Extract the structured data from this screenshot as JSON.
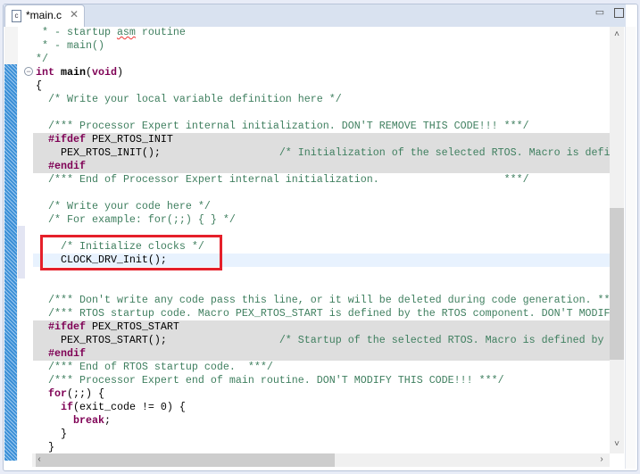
{
  "tab": {
    "title": "*main.c",
    "file_icon": "c-file-icon",
    "close_icon": "close-icon"
  },
  "window": {
    "minimize_icon": "minimize-icon",
    "maximize_icon": "maximize-icon"
  },
  "editor": {
    "fold_icon": "collapse-icon",
    "highlight_color": "#e5202a",
    "lines": [
      {
        "k": "",
        "t": [
          [
            "cm",
            " * - startup "
          ],
          [
            "cm sq",
            "asm"
          ],
          [
            "cm",
            " routine"
          ]
        ]
      },
      {
        "k": "",
        "t": [
          [
            "cm",
            " * - main()"
          ]
        ]
      },
      {
        "k": "",
        "t": [
          [
            "cm",
            "*/"
          ]
        ]
      },
      {
        "k": "",
        "t": [
          [
            "kw",
            "int"
          ],
          [
            "",
            " "
          ],
          [
            "fn",
            "main"
          ],
          [
            "",
            "("
          ],
          [
            "kw",
            "void"
          ],
          [
            "",
            ")"
          ]
        ]
      },
      {
        "k": "",
        "t": [
          [
            "",
            "{"
          ]
        ]
      },
      {
        "k": "",
        "t": [
          [
            "",
            "  "
          ],
          [
            "cm",
            "/* Write your local variable definition here */"
          ]
        ]
      },
      {
        "k": "",
        "t": []
      },
      {
        "k": "",
        "t": [
          [
            "",
            "  "
          ],
          [
            "cm",
            "/*** Processor Expert internal initialization. DON'T REMOVE THIS CODE!!! ***/"
          ]
        ]
      },
      {
        "k": "pp",
        "t": [
          [
            "",
            "  "
          ],
          [
            "kw",
            "#ifdef"
          ],
          [
            "",
            " PEX_RTOS_INIT"
          ]
        ]
      },
      {
        "k": "pp",
        "t": [
          [
            "",
            "    PEX_RTOS_INIT();                   "
          ],
          [
            "cm",
            "/* Initialization of the selected RTOS. Macro is defi"
          ]
        ]
      },
      {
        "k": "pp",
        "t": [
          [
            "",
            "  "
          ],
          [
            "kw",
            "#endif"
          ]
        ]
      },
      {
        "k": "",
        "t": [
          [
            "",
            "  "
          ],
          [
            "cm",
            "/*** End of Processor Expert internal initialization.                    ***/"
          ]
        ]
      },
      {
        "k": "",
        "t": []
      },
      {
        "k": "",
        "t": [
          [
            "",
            "  "
          ],
          [
            "cm",
            "/* Write your code here */"
          ]
        ]
      },
      {
        "k": "",
        "t": [
          [
            "",
            "  "
          ],
          [
            "cm",
            "/* For example: for(;;) { } */"
          ]
        ]
      },
      {
        "k": "",
        "t": []
      },
      {
        "k": "",
        "t": [
          [
            "",
            "    "
          ],
          [
            "cm",
            "/* Initialize clocks */"
          ]
        ]
      },
      {
        "k": "cur",
        "t": [
          [
            "",
            "    CLOCK_DRV_Init();"
          ]
        ]
      },
      {
        "k": "",
        "t": []
      },
      {
        "k": "",
        "t": []
      },
      {
        "k": "",
        "t": [
          [
            "",
            "  "
          ],
          [
            "cm",
            "/*** Don't write any code pass this line, or it will be deleted during code generation. ***/"
          ]
        ]
      },
      {
        "k": "",
        "t": [
          [
            "",
            "  "
          ],
          [
            "cm",
            "/*** RTOS startup code. Macro PEX_RTOS_START is defined by the RTOS component. DON'T MODIFY THIS CODE!!! ***/"
          ]
        ]
      },
      {
        "k": "pp",
        "t": [
          [
            "",
            "  "
          ],
          [
            "kw",
            "#ifdef"
          ],
          [
            "",
            " PEX_RTOS_START"
          ]
        ]
      },
      {
        "k": "pp",
        "t": [
          [
            "",
            "    PEX_RTOS_START();                  "
          ],
          [
            "cm",
            "/* Startup of the selected RTOS. Macro is defined by "
          ]
        ]
      },
      {
        "k": "pp",
        "t": [
          [
            "",
            "  "
          ],
          [
            "kw",
            "#endif"
          ]
        ]
      },
      {
        "k": "",
        "t": [
          [
            "",
            "  "
          ],
          [
            "cm",
            "/*** End of RTOS startup code.  ***/"
          ]
        ]
      },
      {
        "k": "",
        "t": [
          [
            "",
            "  "
          ],
          [
            "cm",
            "/*** Processor Expert end of main routine. DON'T MODIFY THIS CODE!!! ***/"
          ]
        ]
      },
      {
        "k": "",
        "t": [
          [
            "",
            "  "
          ],
          [
            "kw",
            "for"
          ],
          [
            "",
            "(;;) {"
          ]
        ]
      },
      {
        "k": "",
        "t": [
          [
            "",
            "    "
          ],
          [
            "kw",
            "if"
          ],
          [
            "",
            "(exit_code != 0) {"
          ]
        ]
      },
      {
        "k": "",
        "t": [
          [
            "",
            "      "
          ],
          [
            "kw",
            "break"
          ],
          [
            "",
            ";"
          ]
        ]
      },
      {
        "k": "",
        "t": [
          [
            "",
            "    }"
          ]
        ]
      },
      {
        "k": "",
        "t": [
          [
            "",
            "  }"
          ]
        ]
      }
    ]
  }
}
